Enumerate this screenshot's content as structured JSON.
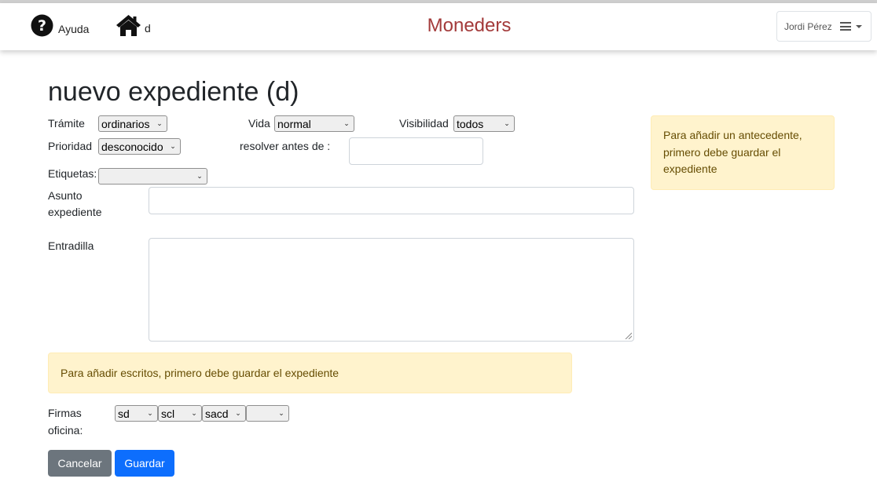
{
  "navbar": {
    "help_label": "Ayuda",
    "home_label": "d",
    "brand": "Moneders",
    "user_name": "Jordi Pérez"
  },
  "page": {
    "title": "nuevo expediente (d)"
  },
  "form": {
    "tramite_label": "Trámite",
    "tramite_value": "ordinarios",
    "vida_label": "Vida",
    "vida_value": "normal",
    "visibilidad_label": "Visibilidad",
    "visibilidad_value": "todos",
    "prioridad_label": "Prioridad",
    "prioridad_value": "desconocido",
    "resolver_label": "resolver antes de :",
    "resolver_value": "",
    "etiquetas_label": "Etiquetas:",
    "etiquetas_value": "",
    "asunto_label_1": "Asunto",
    "asunto_label_2": "expediente",
    "asunto_value": "",
    "entradilla_label": "Entradilla",
    "entradilla_value": "",
    "firmas_label_1": "Firmas",
    "firmas_label_2": "oficina:",
    "firmas": [
      "sd",
      "scl",
      "sacd",
      ""
    ]
  },
  "alerts": {
    "antecedente": "Para añadir un antecedente, primero debe guardar el expediente",
    "escritos": "Para añadir escritos, primero debe guardar el expediente"
  },
  "buttons": {
    "cancel": "Cancelar",
    "save": "Guardar"
  },
  "colors": {
    "brand": "#a33a3a",
    "cancel_bg": "#6c757d",
    "save_bg": "#0d6efd",
    "alert_bg": "#fff3cd",
    "alert_text": "#664d03"
  },
  "icons": {
    "help": "question-circle-icon",
    "home": "home-icon",
    "menu": "hamburger-menu-icon",
    "select_arrow": "chevron-down-icon"
  }
}
